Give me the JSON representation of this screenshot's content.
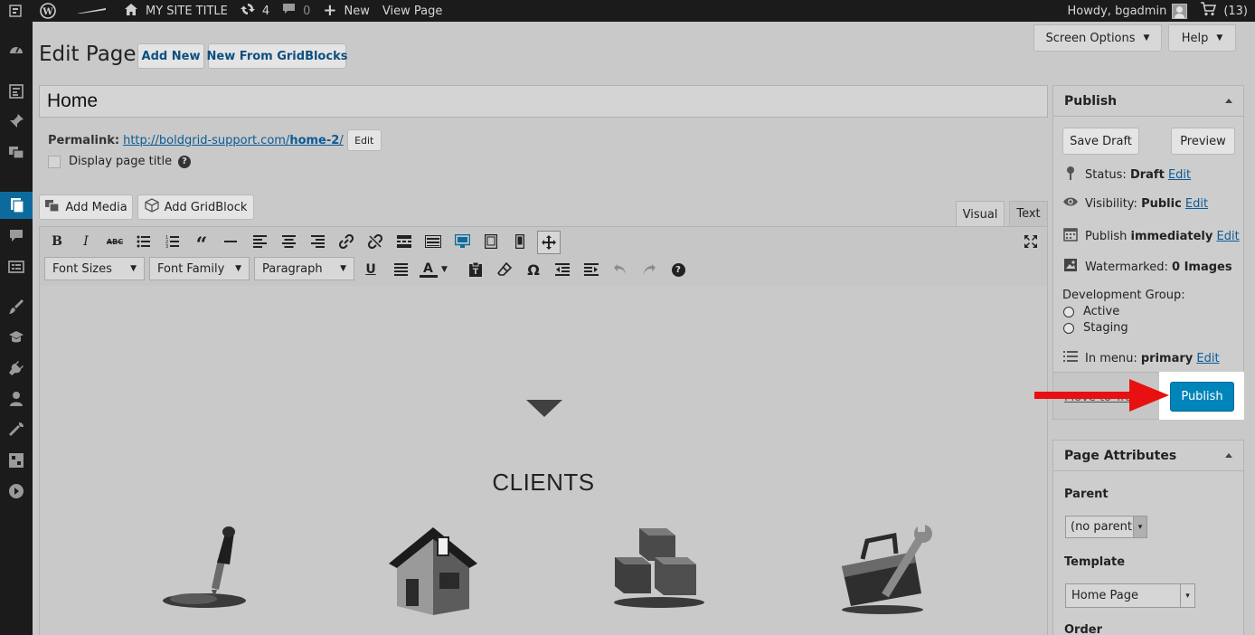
{
  "topbar": {
    "site_title": "MY SITE TITLE",
    "updates_count": "4",
    "comments_count": "0",
    "new_label": "New",
    "view_page_label": "View Page",
    "howdy": "Howdy, bgadmin",
    "cart_count": "(13)"
  },
  "screen_options": {
    "screen_options_label": "Screen Options",
    "help_label": "Help"
  },
  "header": {
    "page_heading": "Edit Page",
    "add_new_label": "Add New",
    "new_from_gridblocks_label": "New From GridBlocks"
  },
  "post": {
    "title_value": "Home",
    "permalink_label": "Permalink:",
    "permalink_prefix": "http://boldgrid-support.com/",
    "permalink_slug": "home-2",
    "permalink_suffix": "/",
    "permalink_edit_label": "Edit",
    "display_title_label": "Display page title"
  },
  "media_buttons": {
    "add_media_label": "Add Media",
    "add_gridblock_label": "Add GridBlock"
  },
  "editor_tabs": {
    "visual_label": "Visual",
    "text_label": "Text"
  },
  "toolbar2": {
    "font_sizes": "Font Sizes",
    "font_family": "Font Family",
    "paragraph": "Paragraph"
  },
  "content": {
    "section_heading": "CLIENTS"
  },
  "publish_box": {
    "title": "Publish",
    "save_draft_label": "Save Draft",
    "preview_label": "Preview",
    "status_label": "Status:",
    "status_value": "Draft",
    "visibility_label": "Visibility:",
    "visibility_value": "Public",
    "publish_label": "Publish",
    "publish_value": "immediately",
    "watermark_label": "Watermarked:",
    "watermark_value": "0 Images",
    "dev_group_label": "Development Group:",
    "dev_options": [
      "Active",
      "Staging"
    ],
    "in_menu_label": "In menu:",
    "in_menu_value": "primary",
    "edit_label": "Edit",
    "move_to_trash_label": "Move to Trash",
    "publish_button_label": "Publish"
  },
  "page_attributes": {
    "title": "Page Attributes",
    "parent_label": "Parent",
    "parent_value": "(no parent)",
    "template_label": "Template",
    "template_value": "Home Page",
    "order_label": "Order"
  },
  "colors": {
    "admin_bar": "#1b1b1b",
    "accent": "#0c6b9c",
    "publish_button": "#0085ba",
    "arrow": "#e81010"
  }
}
